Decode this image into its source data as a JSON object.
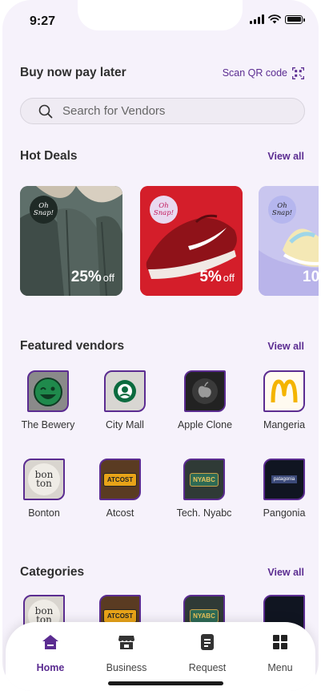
{
  "status": {
    "time": "9:27"
  },
  "bnpl": {
    "title": "Buy now pay later",
    "scan_label": "Scan QR code"
  },
  "search": {
    "placeholder": "Search for Vendors"
  },
  "hot_deals": {
    "title": "Hot Deals",
    "view_all": "View all",
    "items": [
      {
        "badge": "Oh Snap!",
        "percent": "25%",
        "suffix": "off"
      },
      {
        "badge": "Oh Snap!",
        "percent": "5%",
        "suffix": "off"
      },
      {
        "badge": "Oh Snap!",
        "percent": "10",
        "suffix": ""
      }
    ]
  },
  "featured": {
    "title": "Featured vendors",
    "view_all": "View all",
    "vendors": [
      {
        "name": "The Bewery",
        "icon": "beer-smiley-icon"
      },
      {
        "name": "City Mall",
        "icon": "starbucks-icon"
      },
      {
        "name": "Apple Clone",
        "icon": "apple-icon"
      },
      {
        "name": "Mangeria",
        "icon": "mcdonalds-icon"
      },
      {
        "name": "Bonton",
        "icon": "bonton-icon",
        "logo_text": "bon ton"
      },
      {
        "name": "Atcost",
        "icon": "atcost-icon",
        "logo_text": "ATCOST"
      },
      {
        "name": "Tech. Nyabc",
        "icon": "nyabc-icon",
        "logo_text": "NYABC"
      },
      {
        "name": "Pangonia",
        "icon": "patagonia-icon",
        "logo_text": "patagonia"
      }
    ]
  },
  "categories": {
    "title": "Categories",
    "view_all": "View all"
  },
  "nav": {
    "items": [
      {
        "label": "Home",
        "icon": "home-icon",
        "active": true
      },
      {
        "label": "Business",
        "icon": "store-icon",
        "active": false
      },
      {
        "label": "Request",
        "icon": "document-icon",
        "active": false
      },
      {
        "label": "Menu",
        "icon": "grid-icon",
        "active": false
      }
    ]
  },
  "colors": {
    "accent": "#5b2c91",
    "background": "#f6f2fb"
  }
}
